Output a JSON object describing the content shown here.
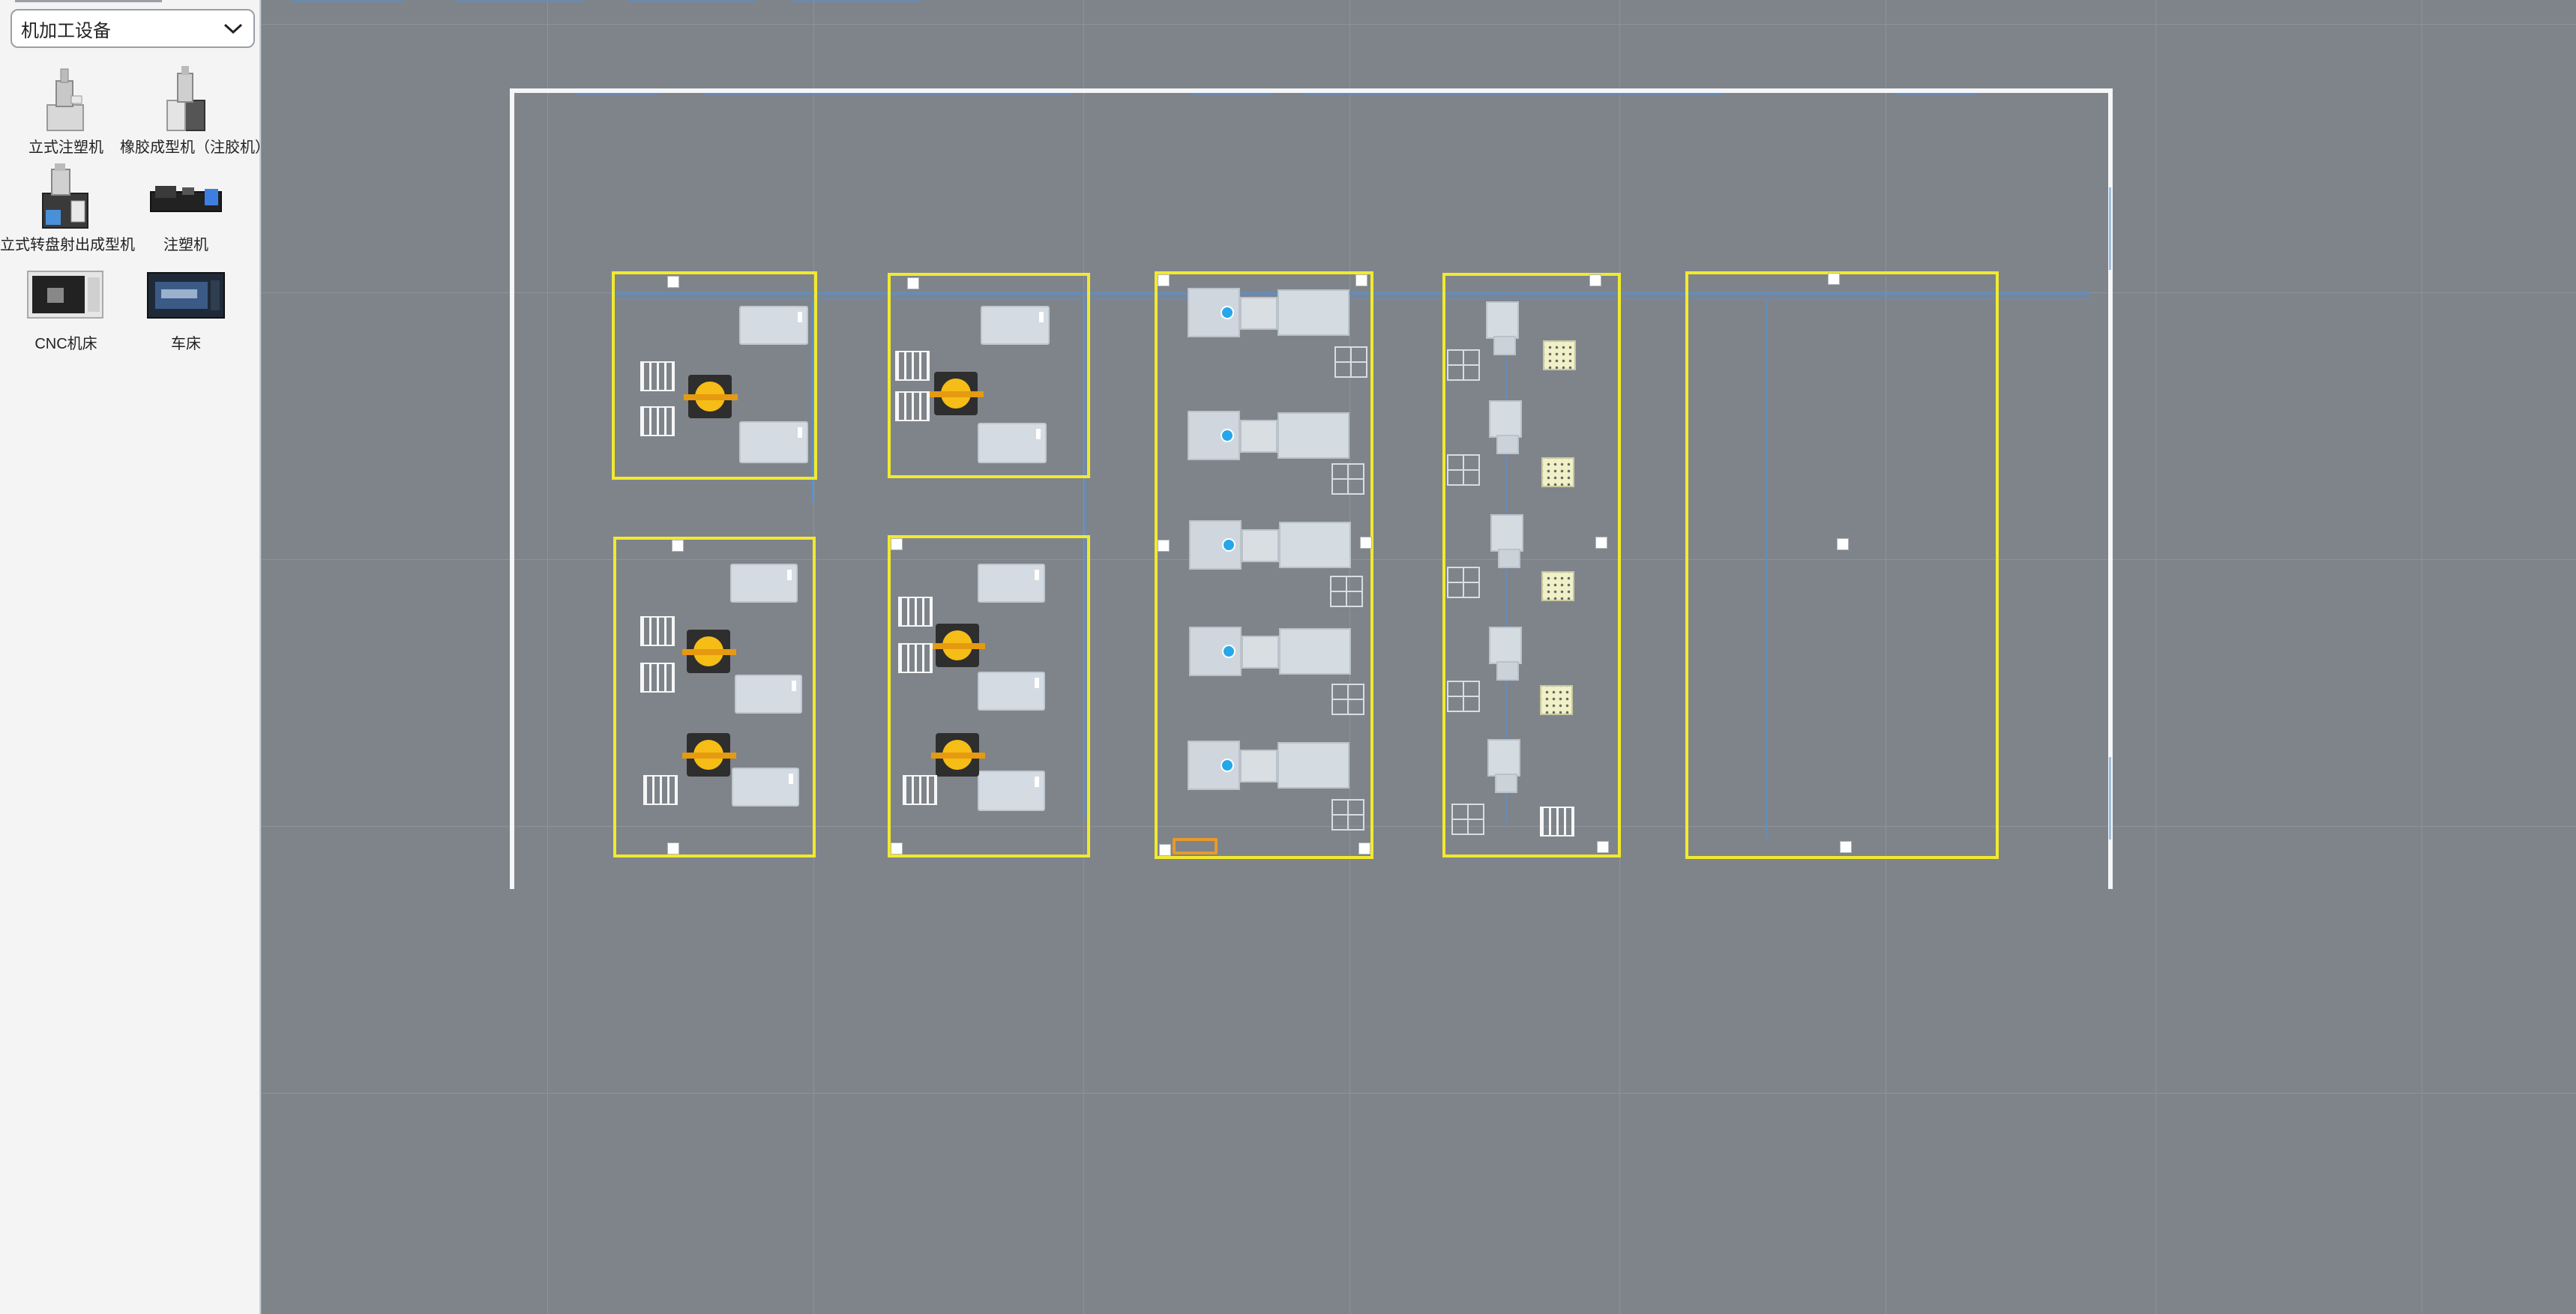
{
  "sidebar": {
    "category_select": {
      "value": "机加工设备"
    },
    "items": [
      {
        "label": "立式注塑机",
        "icon": "vertical-injection-molding-machine-icon"
      },
      {
        "label": "橡胶成型机（注胶机）",
        "icon": "rubber-molding-machine-icon"
      },
      {
        "label": "立式转盘射出成型机",
        "icon": "vertical-rotary-injection-machine-icon"
      },
      {
        "label": "注塑机",
        "icon": "injection-molding-machine-icon"
      },
      {
        "label": "CNC机床",
        "icon": "cnc-machine-icon"
      },
      {
        "label": "车床",
        "icon": "lathe-icon"
      }
    ]
  },
  "colors": {
    "canvas_bg": "#7f848b",
    "zone_border": "#f1ea2e",
    "wall": "#f4f6f8",
    "robot": "#f6bd16",
    "sensor_dot": "#25a7ea",
    "conveyor": "#5b8ec9"
  }
}
